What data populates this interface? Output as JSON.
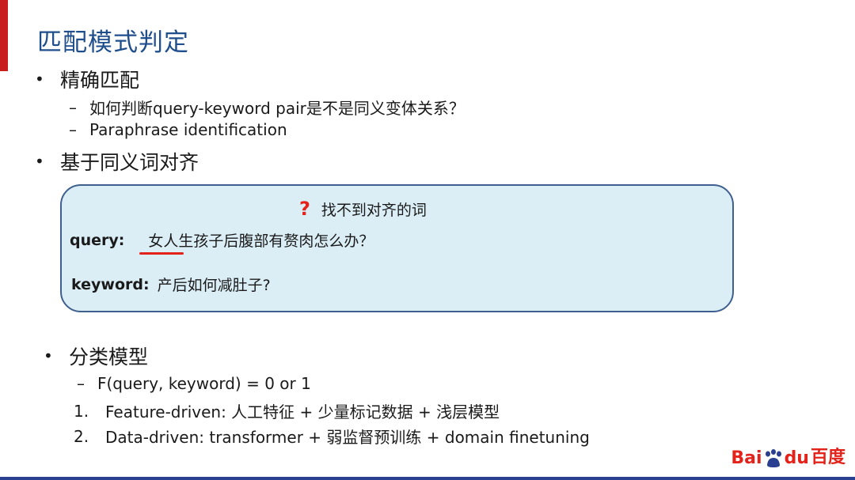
{
  "slide": {
    "title": "匹配模式判定",
    "accent_color": "#c81e1e",
    "title_color": "#1f4e8c"
  },
  "section1": {
    "bullet": "•",
    "heading": "精确匹配",
    "items": [
      {
        "marker": "–",
        "text": "如何判断query-keyword pair是不是同义变体关系？"
      },
      {
        "marker": "–",
        "text": "Paraphrase identification"
      }
    ]
  },
  "section2": {
    "bullet": "•",
    "heading": "基于同义词对齐",
    "callout": {
      "hint_icon": "question-mark-icon",
      "hint_mark": "?",
      "hint_text": "找不到对齐的词",
      "query_label": "query:",
      "query_text": "女人生孩子后腹部有赘肉怎么办？",
      "keyword_label": "keyword:",
      "keyword_text": "产后如何减肚子?"
    }
  },
  "section3": {
    "bullet": "•",
    "heading": "分类模型",
    "formula_marker": "–",
    "formula": "F(query, keyword) = 0 or 1",
    "numbered": [
      {
        "n": "1.",
        "text": "Feature-driven: 人工特征 + 少量标记数据 + 浅层模型"
      },
      {
        "n": "2.",
        "text": "Data-driven:  transformer + 弱监督预训练 + domain finetuning"
      }
    ]
  },
  "logo": {
    "bai": "Bai",
    "du": "du",
    "cn": "百度"
  }
}
